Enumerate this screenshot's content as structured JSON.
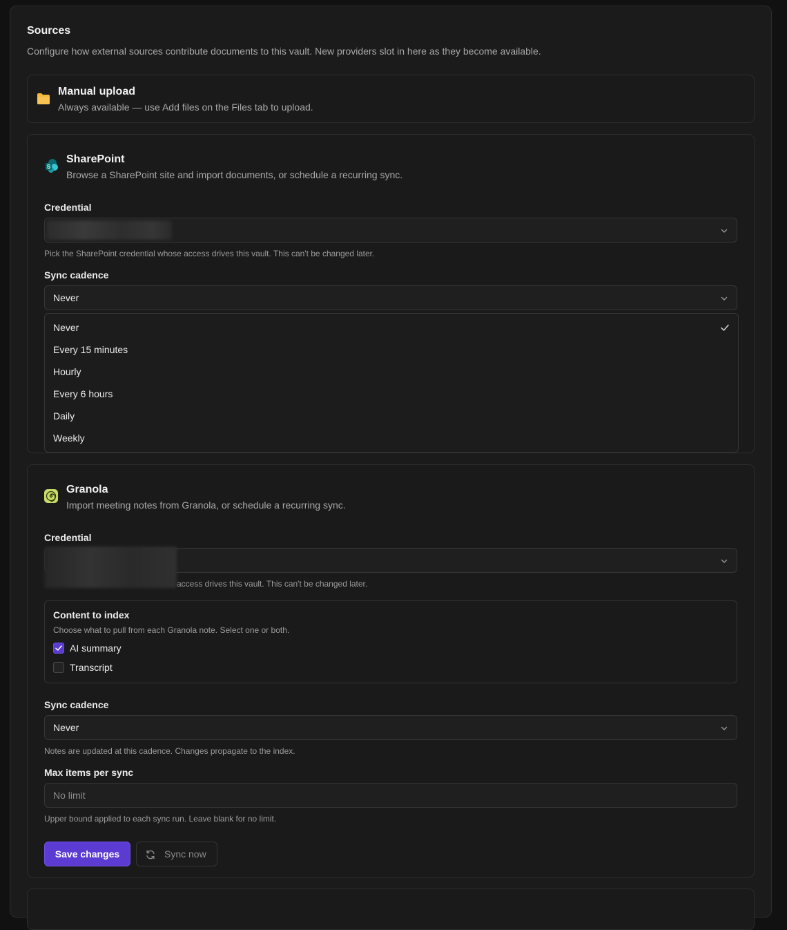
{
  "section": {
    "title": "Sources",
    "description": "Configure how external sources contribute documents to this vault. New providers slot in here as they become available."
  },
  "manual_upload": {
    "title": "Manual upload",
    "description": "Always available — use Add files on the Files tab to upload.",
    "icon": "folder-icon",
    "icon_color": "#f5b83d"
  },
  "sharepoint": {
    "title": "SharePoint",
    "description": "Browse a SharePoint site and import documents, or schedule a recurring sync.",
    "icon": "sharepoint-icon",
    "credential_label": "Credential",
    "credential_hint": "Pick the SharePoint credential whose access drives this vault. This can't be changed later.",
    "sync_label": "Sync cadence",
    "sync_value": "Never",
    "sync_options": [
      {
        "label": "Never",
        "selected": true
      },
      {
        "label": "Every 15 minutes",
        "selected": false
      },
      {
        "label": "Hourly",
        "selected": false
      },
      {
        "label": "Every 6 hours",
        "selected": false
      },
      {
        "label": "Daily",
        "selected": false
      },
      {
        "label": "Weekly",
        "selected": false
      }
    ]
  },
  "granola": {
    "title": "Granola",
    "description": "Import meeting notes from Granola, or schedule a recurring sync.",
    "icon": "granola-icon",
    "icon_color": "#c8dc6a",
    "credential_label": "Credential",
    "credential_hint_visible": "access drives this vault. This can't be changed later.",
    "content_title": "Content to index",
    "content_desc": "Choose what to pull from each Granola note. Select one or both.",
    "options": [
      {
        "label": "AI summary",
        "checked": true
      },
      {
        "label": "Transcript",
        "checked": false
      }
    ],
    "sync_label": "Sync cadence",
    "sync_value": "Never",
    "sync_hint": "Notes are updated at this cadence. Changes propagate to the index.",
    "max_label": "Max items per sync",
    "max_placeholder": "No limit",
    "max_hint": "Upper bound applied to each sync run. Leave blank for no limit.",
    "save_label": "Save changes",
    "sync_now_label": "Sync now"
  },
  "colors": {
    "accent": "#5b3bd1",
    "background": "#1b1b1b"
  }
}
